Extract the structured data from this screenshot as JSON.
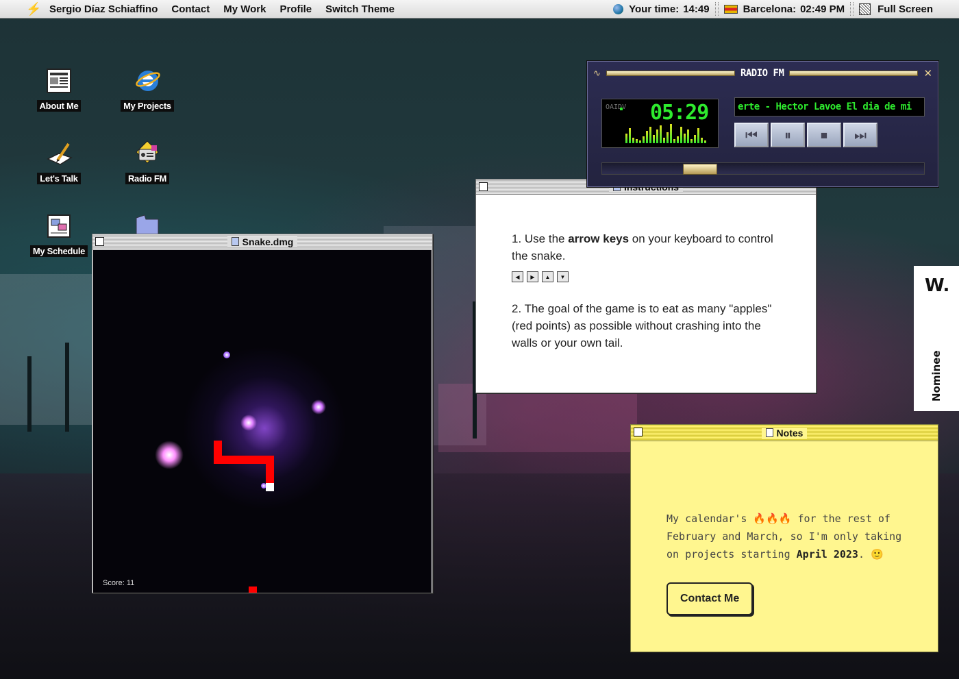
{
  "menubar": {
    "brand": "Sergio Díaz Schiaffino",
    "items": [
      "Contact",
      "My Work",
      "Profile",
      "Switch Theme"
    ],
    "your_time_label": "Your time:",
    "your_time": "14:49",
    "city_label": "Barcelona:",
    "city_time": "02:49 PM",
    "fullscreen": "Full Screen"
  },
  "desktop": {
    "icons": [
      {
        "label": "About Me",
        "icon": "newspaper-icon"
      },
      {
        "label": "My Projects",
        "icon": "internet-explorer-icon"
      },
      {
        "label": "Let's Talk",
        "icon": "pencil-paper-icon"
      },
      {
        "label": "Radio FM",
        "icon": "radio-icon"
      },
      {
        "label": "My Schedule",
        "icon": "schedule-icon"
      },
      {
        "label": "",
        "icon": "folder-icon"
      }
    ]
  },
  "snake_window": {
    "title": "Snake.dmg",
    "score_label": "Score:",
    "score": "11"
  },
  "radio": {
    "title": "RADIO FM",
    "time": "05:29",
    "side_text": "OAIDV",
    "marquee": "erte - Hector Lavoe   El dia de mi",
    "buttons": [
      "prev",
      "pause",
      "stop",
      "next"
    ]
  },
  "instructions": {
    "title": "Instructions",
    "step1_prefix": "1. Use the ",
    "step1_bold": "arrow keys",
    "step1_suffix": " on your keyboard to control the snake.",
    "step2": "2. The goal of the game is to eat as many \"apples\" (red points) as possible without crashing into the walls or your own tail."
  },
  "notes": {
    "title": "Notes",
    "text_prefix": "My calendar's 🔥🔥🔥 for the rest of February and March, so I'm only taking on projects starting ",
    "text_bold": "April 2023",
    "text_suffix": ". 🙂",
    "button": "Contact Me"
  },
  "award": {
    "logo": "W.",
    "label": "Nominee"
  }
}
